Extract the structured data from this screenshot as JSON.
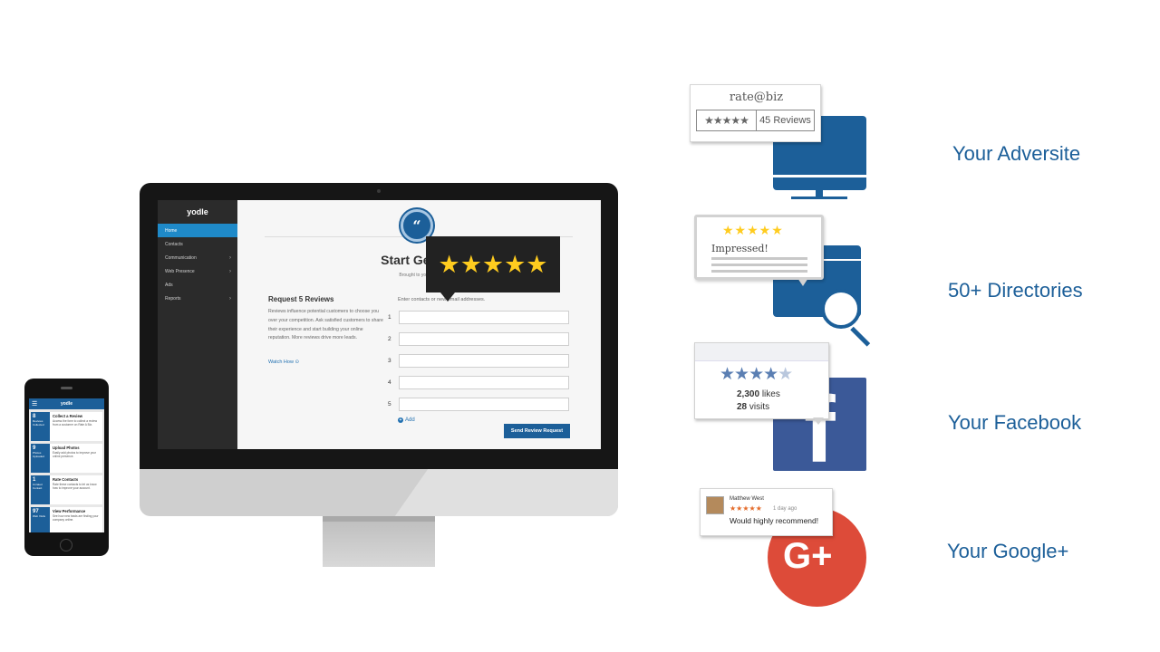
{
  "monitor": {
    "app": {
      "logo": "yodle",
      "nav": [
        {
          "label": "Home",
          "active": true,
          "has_submenu": false
        },
        {
          "label": "Contacts",
          "active": false,
          "has_submenu": false
        },
        {
          "label": "Communication",
          "active": false,
          "has_submenu": true
        },
        {
          "label": "Web Presence",
          "active": false,
          "has_submenu": true
        },
        {
          "label": "Ads",
          "active": false,
          "has_submenu": false
        },
        {
          "label": "Reports",
          "active": false,
          "has_submenu": true
        }
      ],
      "badge_icon": "quote-icon",
      "badge_glyph": "“",
      "headline": "Start Getting",
      "byline": "Brought to you by R",
      "request_title": "Request 5 Reviews",
      "request_body": "Reviews influence potential customers to choose you over your competition. Ask satisfied customers to share their experience and start building your online reputation. More reviews drive more leads.",
      "watch_link": "Watch How",
      "input_label": "Enter contacts or new email addresses.",
      "rows": [
        "1",
        "2",
        "3",
        "4",
        "5"
      ],
      "add_label": "Add",
      "send_button": "Send Review Request"
    },
    "rating_popup": {
      "stars": 5,
      "glyph": "★★★★★"
    }
  },
  "phone": {
    "logo": "yodle",
    "menu_glyph": "☰",
    "cards": [
      {
        "number": "8",
        "stat_label": "Reviews Collected",
        "title": "Collect a Review",
        "desc": "Access the form to collect a review from a customer on Rate A Biz."
      },
      {
        "number": "9",
        "stat_label": "Photos Uploaded",
        "title": "Upload Photos",
        "desc": "Easily add photos to improve your online presence."
      },
      {
        "number": "1",
        "stat_label": "Unrated Contact",
        "title": "Rate Contacts",
        "desc": "Rate these contacts to let us know how to improve your account."
      },
      {
        "number": "97",
        "stat_label": "Web Visits",
        "title": "View Performance",
        "desc": "See how new leads are finding your company online."
      }
    ]
  },
  "right": {
    "rateabiz": {
      "logo": "rate@biz",
      "stars": "★★★★★",
      "reviews": "45 Reviews",
      "label": "Your Adversite"
    },
    "directories": {
      "stars": "★★★★★",
      "text": "Impressed!",
      "label": "50+ Directories"
    },
    "facebook": {
      "stars": "★★★★",
      "half_star": "★",
      "likes_number": "2,300",
      "likes_text": "likes",
      "visits_number": "28",
      "visits_text": "visits",
      "label": "Your Facebook"
    },
    "google": {
      "name": "Matthew West",
      "stars": "★★★★★",
      "time": "1 day ago",
      "quote": "Would highly recommend!",
      "label": "Your Google+"
    }
  },
  "colors": {
    "brand_blue": "#1c5f99",
    "star_yellow": "#ffcc1f",
    "facebook_blue": "#3b5998",
    "google_red": "#dd4b39"
  }
}
